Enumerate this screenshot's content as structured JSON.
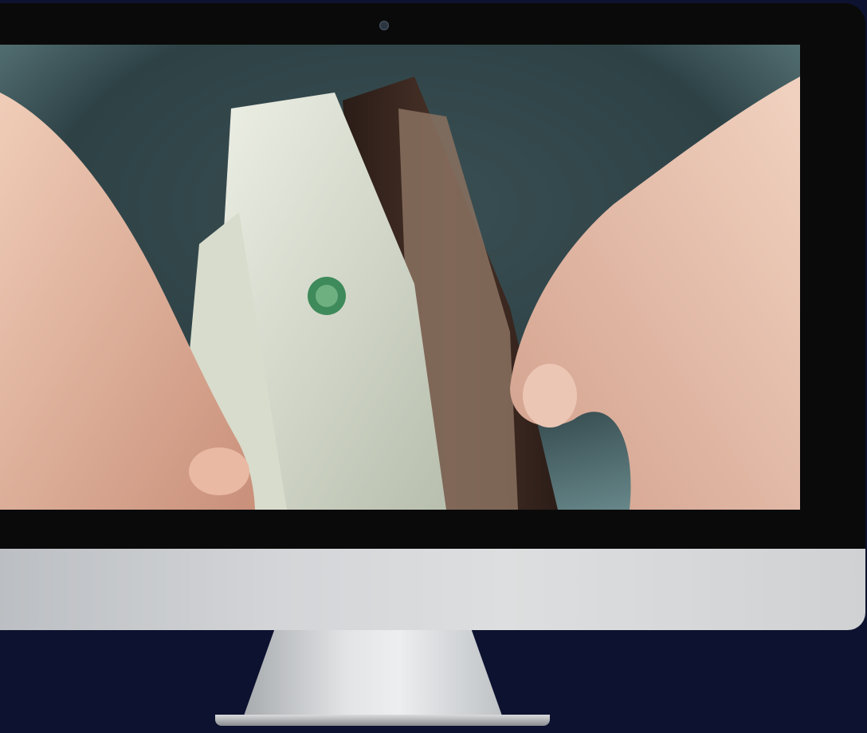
{
  "scene": {
    "description_icon": "monitor-with-wallet-photo",
    "colors": {
      "background": "#0d1230",
      "bezel": "#0a0a0a",
      "chin": "#d3d5d8",
      "stand": "#e2e4e6",
      "photo_backdrop": "#3d5a5e",
      "wallet": "#3a2820",
      "skin": "#e8c3ae",
      "bill_green": "#3f8a5a"
    }
  }
}
